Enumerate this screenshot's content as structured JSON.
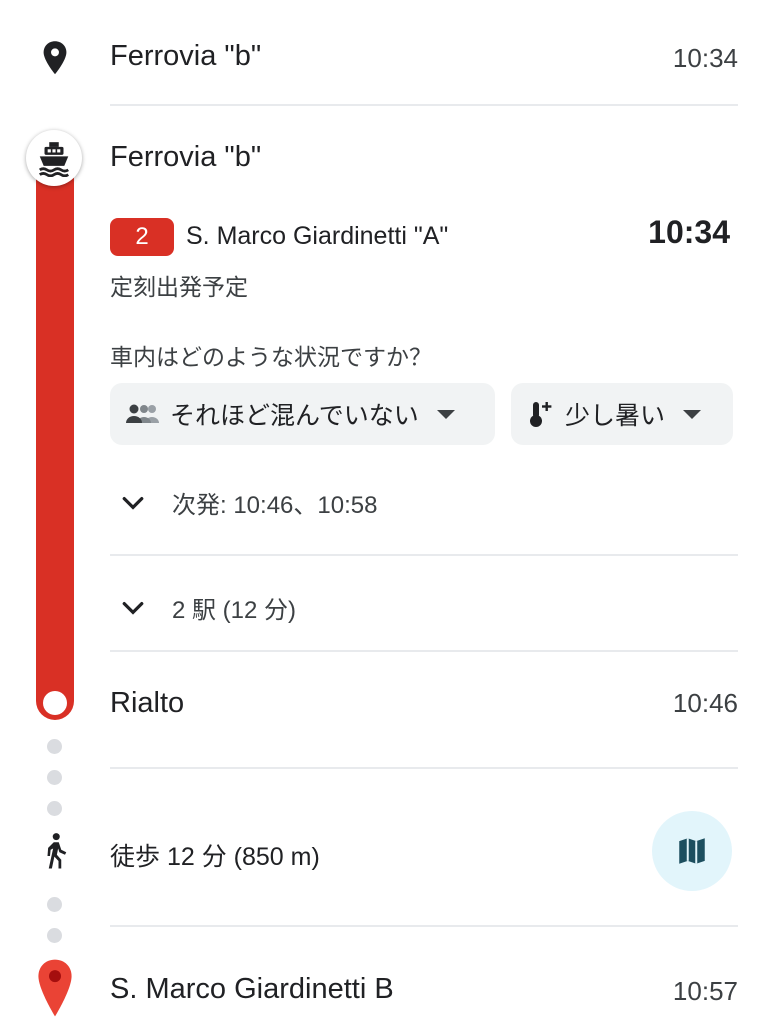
{
  "origin": {
    "name": "Ferrovia \"b\"",
    "time": "10:34"
  },
  "transit": {
    "departure_stop": "Ferrovia \"b\"",
    "line_number": "2",
    "direction": "S. Marco Giardinetti \"A\"",
    "departure_time": "10:34",
    "status": "定刻出発予定",
    "crowd_question": "車内はどのような状況ですか？",
    "crowding_chip": "それほど混んでいない",
    "temperature_chip": "少し暑い",
    "next_departures": "次発: 10:46、10:58",
    "stops_summary": "2 駅 (12 分)",
    "arrival_stop": "Rialto",
    "arrival_time": "10:46"
  },
  "walk": {
    "summary": "徒歩 12 分 (850 m)"
  },
  "destination": {
    "name": "S. Marco Giardinetti B",
    "time": "10:57"
  },
  "colors": {
    "line": "#d93025",
    "divider": "#e8eaed",
    "map_button_bg": "#e2f5fb",
    "map_icon": "#1d4f5f"
  }
}
